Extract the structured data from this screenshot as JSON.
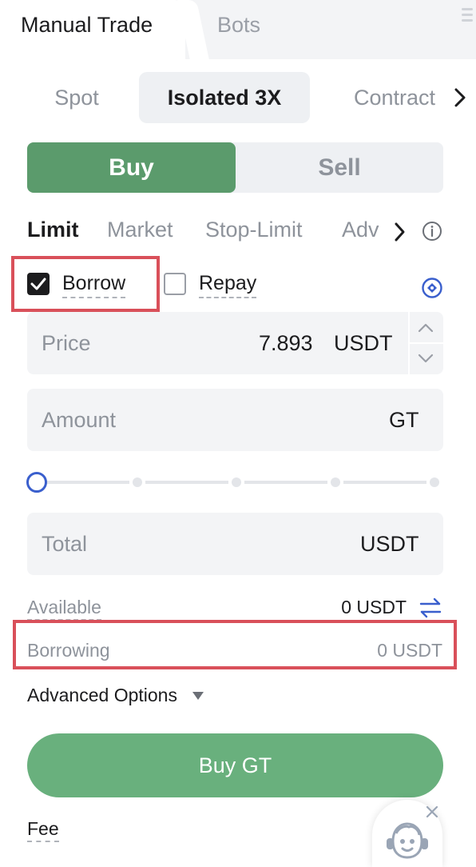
{
  "top_tabs": {
    "manual": "Manual Trade",
    "bots": "Bots"
  },
  "mode_tabs": [
    {
      "label": "Spot",
      "active": false
    },
    {
      "label": "Isolated 3X",
      "active": true
    },
    {
      "label": "Contract",
      "active": false
    }
  ],
  "side": {
    "buy": "Buy",
    "sell": "Sell",
    "selected": "Buy"
  },
  "order_types": [
    "Limit",
    "Market",
    "Stop-Limit",
    "Adv"
  ],
  "selected_order_type": "Limit",
  "margin_options": {
    "borrow": {
      "label": "Borrow",
      "checked": true
    },
    "repay": {
      "label": "Repay",
      "checked": false
    }
  },
  "price": {
    "label": "Price",
    "value": "7.893",
    "unit": "USDT"
  },
  "amount": {
    "label": "Amount",
    "value": "",
    "unit": "GT"
  },
  "slider": {
    "level_percent": 0
  },
  "total": {
    "label": "Total",
    "value": "",
    "unit": "USDT"
  },
  "available": {
    "label": "Available",
    "value": "0 USDT"
  },
  "borrowing": {
    "label": "Borrowing",
    "value": "0 USDT"
  },
  "advanced_options": "Advanced Options",
  "submit": "Buy GT",
  "fee": "Fee",
  "colors": {
    "buy_green": "#5b9b6c",
    "submit_green": "#69b07d",
    "accent_blue": "#3a5fcd",
    "highlight_red": "#d9505a"
  },
  "icons": [
    "menu-icon",
    "chevron-right-icon",
    "info-icon",
    "check-icon",
    "target-icon",
    "chevron-up-icon",
    "chevron-down-icon",
    "swap-icon",
    "caret-down-icon",
    "support-icon",
    "close-icon"
  ]
}
